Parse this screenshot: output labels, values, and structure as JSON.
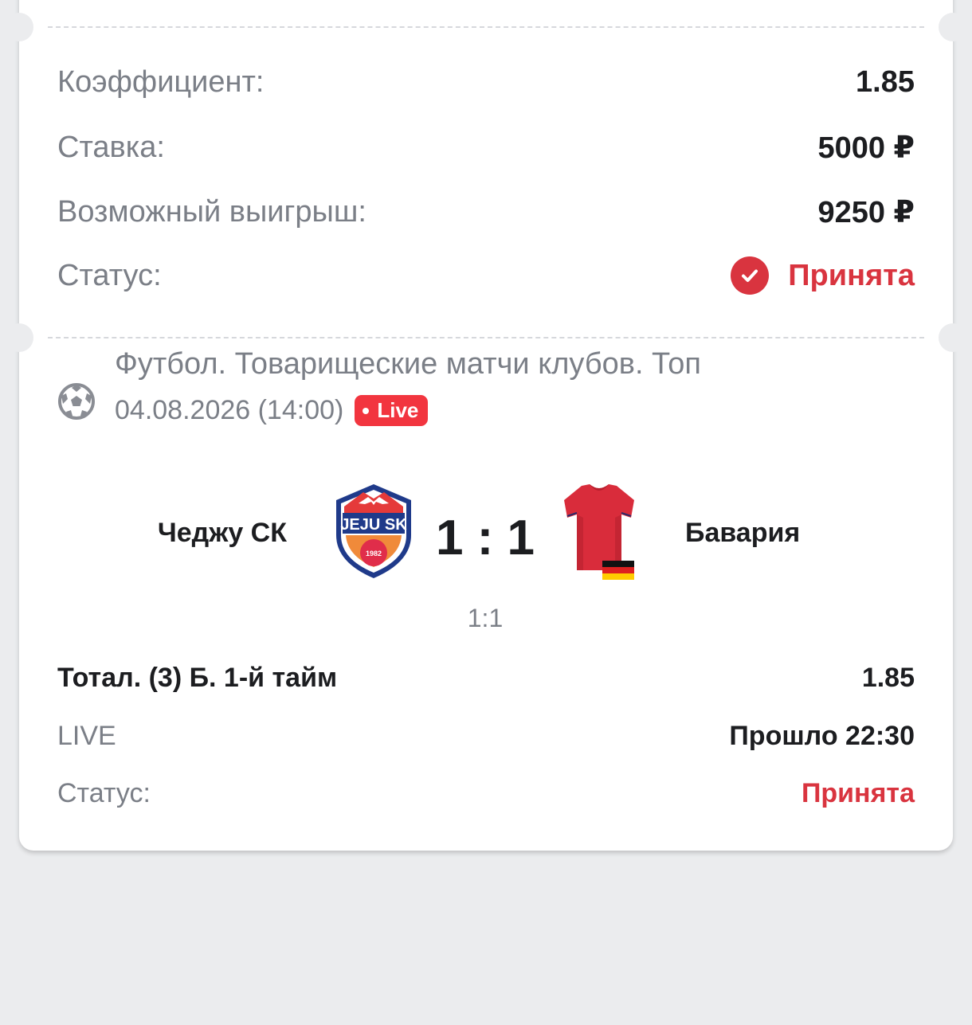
{
  "summary": {
    "coef_label": "Коэффициент:",
    "coef_value": "1.85",
    "stake_label": "Ставка:",
    "stake_value": "5000 ₽",
    "payout_label": "Возможный выигрыш:",
    "payout_value": "9250 ₽",
    "status_label": "Статус:",
    "status_value": "Принята"
  },
  "event": {
    "league": "Футбол. Товарищеские матчи клубов. Топ",
    "datetime": "04.08.2026 (14:00)",
    "live_badge": "Live",
    "team_home": "Чеджу СК",
    "team_away": "Бавария",
    "home_logo_text": "JEJU SK",
    "home_logo_year": "1982",
    "score": "1 : 1",
    "half_score": "1:1"
  },
  "bet": {
    "market": "Тотал. (3) Б. 1-й тайм",
    "odds": "1.85",
    "mode_label": "LIVE",
    "elapsed": "Прошло 22:30",
    "status_label": "Статус:",
    "status_value": "Принята"
  },
  "colors": {
    "accent_red": "#d9343f",
    "live_red": "#f2353f",
    "background": "#ebecee"
  }
}
